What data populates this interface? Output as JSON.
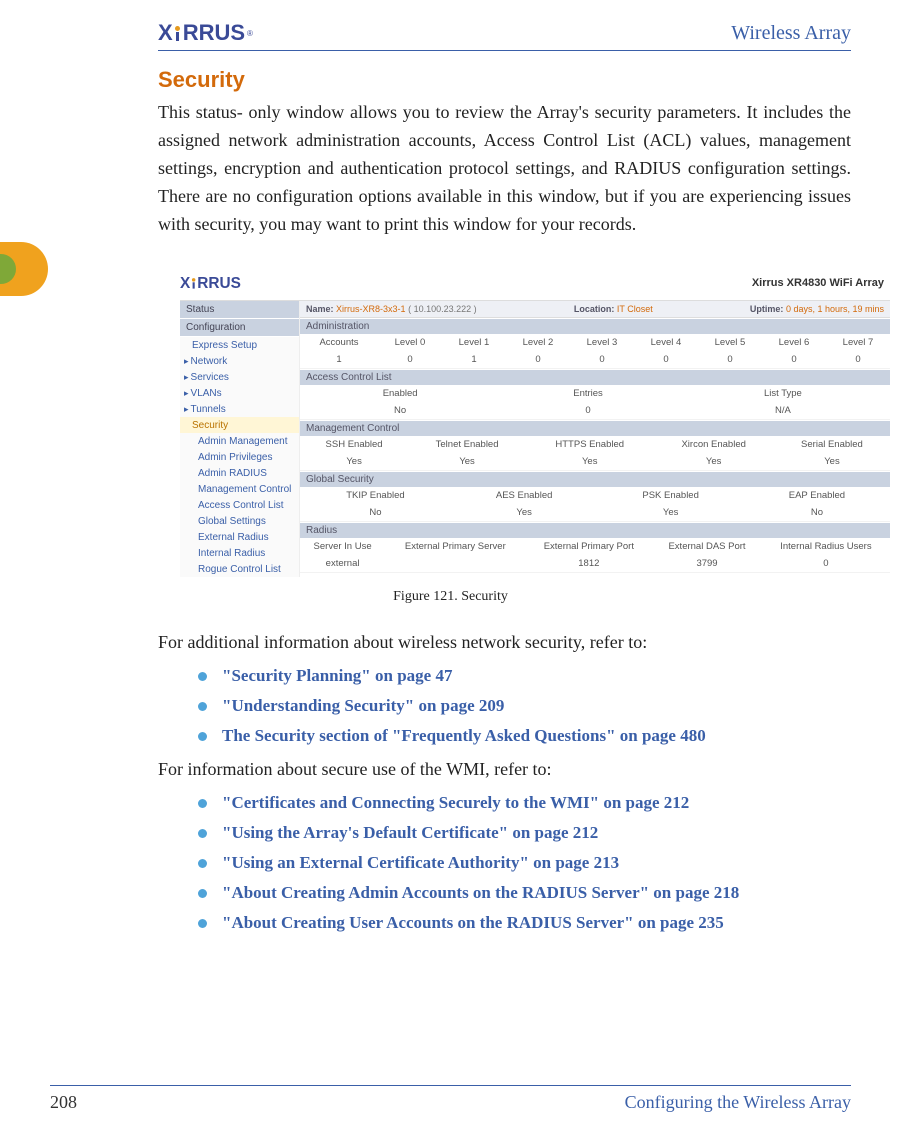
{
  "header": {
    "logo_text_x": "X",
    "logo_text_rest": "RRUS",
    "product_line": "Wireless Array"
  },
  "section": {
    "title": "Security",
    "paragraph": "This status- only window allows you to review the Array's security parameters. It includes the assigned network administration accounts, Access Control List (ACL) values, management settings, encryption and authentication protocol settings, and RADIUS configuration settings. There are no configuration options available in this window, but if you are experiencing issues with security, you may want to print this window for your records."
  },
  "screenshot": {
    "product_title": "Xirrus XR4830 WiFi Array",
    "statusbar": {
      "name_label": "Name:",
      "name_value": "Xirrus-XR8-3x3-1",
      "ip_value": "( 10.100.23.222 )",
      "location_label": "Location:",
      "location_value": "IT Closet",
      "uptime_label": "Uptime:",
      "uptime_value": "0 days, 1 hours, 19 mins"
    },
    "nav": {
      "status": "Status",
      "configuration": "Configuration",
      "items": [
        {
          "label": "Express Setup"
        },
        {
          "label": "Network"
        },
        {
          "label": "Services"
        },
        {
          "label": "VLANs"
        },
        {
          "label": "Tunnels"
        },
        {
          "label": "Security"
        },
        {
          "label": "Admin Management"
        },
        {
          "label": "Admin Privileges"
        },
        {
          "label": "Admin RADIUS"
        },
        {
          "label": "Management Control"
        },
        {
          "label": "Access Control List"
        },
        {
          "label": "Global Settings"
        },
        {
          "label": "External Radius"
        },
        {
          "label": "Internal Radius"
        },
        {
          "label": "Rogue Control List"
        }
      ]
    },
    "sections": {
      "admin": {
        "title": "Administration",
        "headers": [
          "Accounts",
          "Level 0",
          "Level 1",
          "Level 2",
          "Level 3",
          "Level 4",
          "Level 5",
          "Level 6",
          "Level 7"
        ],
        "row": [
          "1",
          "0",
          "1",
          "0",
          "0",
          "0",
          "0",
          "0",
          "0"
        ]
      },
      "acl": {
        "title": "Access Control List",
        "headers": [
          "Enabled",
          "Entries",
          "List Type"
        ],
        "row": [
          "No",
          "0",
          "N/A"
        ]
      },
      "mgmt": {
        "title": "Management Control",
        "headers": [
          "SSH Enabled",
          "Telnet Enabled",
          "HTTPS Enabled",
          "Xircon Enabled",
          "Serial Enabled"
        ],
        "row": [
          "Yes",
          "Yes",
          "Yes",
          "Yes",
          "Yes"
        ]
      },
      "global": {
        "title": "Global Security",
        "headers": [
          "TKIP Enabled",
          "AES Enabled",
          "PSK Enabled",
          "EAP Enabled"
        ],
        "row": [
          "No",
          "Yes",
          "Yes",
          "No"
        ]
      },
      "radius": {
        "title": "Radius",
        "headers": [
          "Server In Use",
          "External Primary Server",
          "External Primary Port",
          "External DAS Port",
          "Internal Radius Users"
        ],
        "row": [
          "external",
          "",
          "1812",
          "3799",
          "0"
        ]
      }
    }
  },
  "figure_caption": "Figure 121. Security",
  "after_fig_1": "For additional information about wireless network security, refer to:",
  "links1": [
    "\"Security Planning\" on page 47",
    "\"Understanding Security\" on page 209",
    "The Security section of \"Frequently Asked Questions\" on page 480"
  ],
  "after_fig_2": "For information about secure use of the WMI, refer to:",
  "links2": [
    "\"Certificates and Connecting Securely to the WMI\" on page 212",
    "\"Using the Array's Default Certificate\" on page 212",
    "\"Using an External Certificate Authority\" on page 213",
    "\"About Creating Admin Accounts on the RADIUS Server\" on page 218",
    "\"About Creating User Accounts on the RADIUS Server\" on page 235"
  ],
  "footer": {
    "page": "208",
    "section": "Configuring the Wireless Array"
  }
}
